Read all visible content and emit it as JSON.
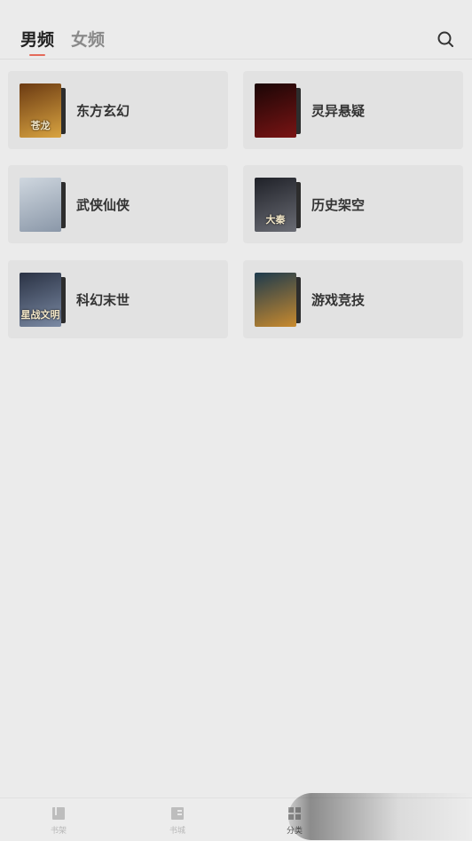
{
  "tabs": {
    "male": "男频",
    "female": "女频"
  },
  "categories": [
    {
      "label": "东方玄幻",
      "cover_text": "苍龙",
      "cover_colors": [
        "#6b3a12",
        "#d9a441"
      ]
    },
    {
      "label": "灵异悬疑",
      "cover_text": "",
      "cover_colors": [
        "#1a0606",
        "#7a1414"
      ]
    },
    {
      "label": "武侠仙侠",
      "cover_text": "",
      "cover_colors": [
        "#cfd7df",
        "#8a97a8"
      ]
    },
    {
      "label": "历史架空",
      "cover_text": "大秦",
      "cover_colors": [
        "#1f2128",
        "#6a6c74"
      ]
    },
    {
      "label": "科幻末世",
      "cover_text": "星战文明",
      "cover_colors": [
        "#2a3244",
        "#7b8aa4"
      ]
    },
    {
      "label": "游戏竞技",
      "cover_text": "",
      "cover_colors": [
        "#1d3a4d",
        "#c98a2e"
      ]
    }
  ],
  "bottom_nav": [
    "书架",
    "书城",
    "分类"
  ],
  "colors": {
    "accent": "#e46a5a"
  }
}
